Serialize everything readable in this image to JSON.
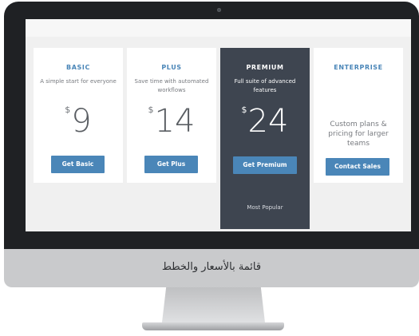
{
  "pricing": {
    "plans": [
      {
        "id": "basic",
        "title": "BASIC",
        "description": "A simple start for everyone",
        "currency": "$",
        "price": "9",
        "button_label": "Get Basic"
      },
      {
        "id": "plus",
        "title": "PLUS",
        "description": "Save time with automated workflows",
        "currency": "$",
        "price": "14",
        "button_label": "Get Plus"
      },
      {
        "id": "premium",
        "title": "PREMIUM",
        "description": "Full suite of advanced features",
        "currency": "$",
        "price": "24",
        "button_label": "Get Premium",
        "tagline": "Most Popular"
      },
      {
        "id": "enterprise",
        "title": "ENTERPRISE",
        "description": "Custom plans & pricing for larger teams",
        "button_label": "Contact Sales"
      }
    ]
  },
  "monitor": {
    "caption": "قائمة بالأسعار والخطط"
  },
  "colors": {
    "accent": "#4a86b8",
    "premium_card": "#3e4550",
    "screen_background": "#f0f0f0"
  }
}
